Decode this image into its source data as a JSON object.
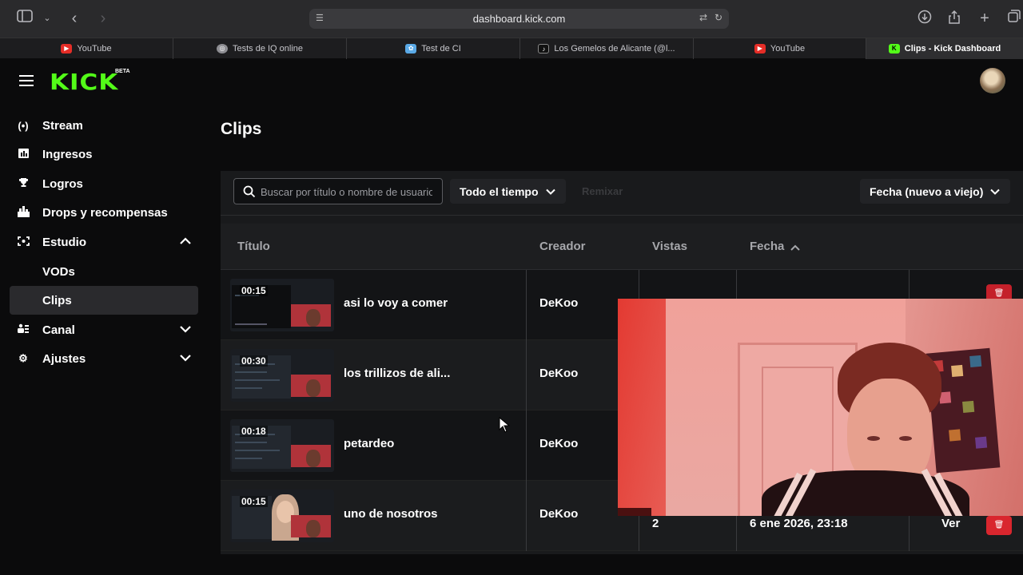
{
  "browser": {
    "url": "dashboard.kick.com",
    "tabs": [
      {
        "label": "YouTube",
        "favicon": "youtube-icon",
        "color": "#e52d27"
      },
      {
        "label": "Tests de IQ online",
        "favicon": "globe-icon",
        "color": "#8e8e93"
      },
      {
        "label": "Test de CI",
        "favicon": "brain-icon",
        "color": "#5aa9e6"
      },
      {
        "label": "Los Gemelos de Alicante (@l...",
        "favicon": "tiktok-icon",
        "color": "#111111"
      },
      {
        "label": "YouTube",
        "favicon": "youtube-icon",
        "color": "#e52d27"
      },
      {
        "label": "Clips - Kick Dashboard",
        "favicon": "kick-icon",
        "color": "#53fc18"
      }
    ]
  },
  "app": {
    "logo": "KICK",
    "beta": "BETA",
    "brand_color": "#53fc18"
  },
  "sidebar": {
    "items": [
      {
        "label": "Stream",
        "icon": "broadcast-icon"
      },
      {
        "label": "Ingresos",
        "icon": "bar-chart-icon"
      },
      {
        "label": "Logros",
        "icon": "trophy-icon"
      },
      {
        "label": "Drops y recompensas",
        "icon": "gift-icon"
      },
      {
        "label": "Estudio",
        "icon": "studio-icon",
        "chevron": "up"
      },
      {
        "label": "VODs"
      },
      {
        "label": "Clips",
        "selected": true
      },
      {
        "label": "Canal",
        "icon": "channel-icon",
        "chevron": "down"
      },
      {
        "label": "Ajustes",
        "icon": "gear-icon",
        "chevron": "down"
      }
    ]
  },
  "main": {
    "title": "Clips",
    "search_placeholder": "Buscar por título o nombre de usuario",
    "time_filter": "Todo el tiempo",
    "remix_label": "Remixar",
    "sort": "Fecha (nuevo a viejo)",
    "columns": {
      "title": "Título",
      "creator": "Creador",
      "views": "Vistas",
      "date": "Fecha"
    },
    "rows": [
      {
        "duration": "00:15",
        "title": "asi lo voy a comer",
        "creator": "DeKoo"
      },
      {
        "duration": "00:30",
        "title": "los trillizos de ali...",
        "creator": "DeKoo"
      },
      {
        "duration": "00:18",
        "title": "petardeo",
        "creator": "DeKoo"
      },
      {
        "duration": "00:15",
        "title": "uno de nosotros",
        "creator": "DeKoo",
        "views": "2",
        "date": "6 ene 2026, 23:18",
        "action": "Ver"
      }
    ]
  }
}
